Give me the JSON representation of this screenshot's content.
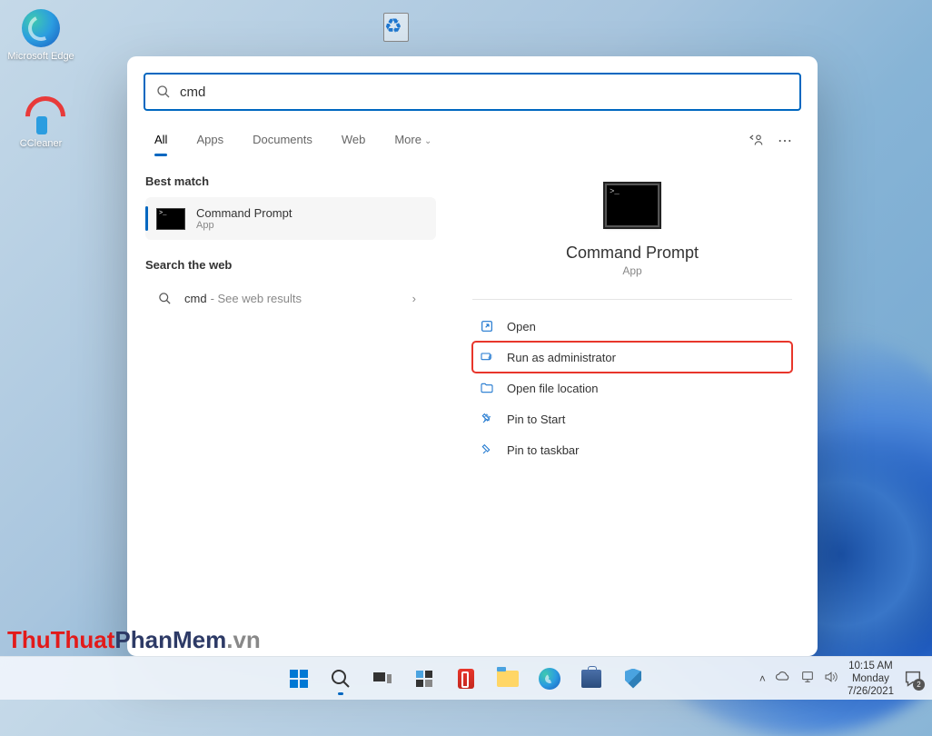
{
  "desktop": {
    "icons": [
      {
        "label": "Microsoft Edge"
      },
      {
        "label": "CCleaner"
      }
    ]
  },
  "search": {
    "query": "cmd",
    "tabs": {
      "all": "All",
      "apps": "Apps",
      "documents": "Documents",
      "web": "Web",
      "more": "More"
    },
    "left": {
      "best_match_header": "Best match",
      "result_title": "Command Prompt",
      "result_sub": "App",
      "web_header": "Search the web",
      "web_query": "cmd",
      "web_suffix": "- See web results"
    },
    "right": {
      "hero_title": "Command Prompt",
      "hero_sub": "App",
      "actions": {
        "open": "Open",
        "admin": "Run as administrator",
        "loc": "Open file location",
        "pin_start": "Pin to Start",
        "pin_taskbar": "Pin to taskbar"
      }
    }
  },
  "taskbar": {
    "clock": {
      "time": "10:15 AM",
      "day": "Monday",
      "date": "7/26/2021"
    },
    "notif_count": "2"
  },
  "watermark": {
    "p1": "ThuThuat",
    "p2": "PhanMem",
    "p3": ".vn"
  }
}
